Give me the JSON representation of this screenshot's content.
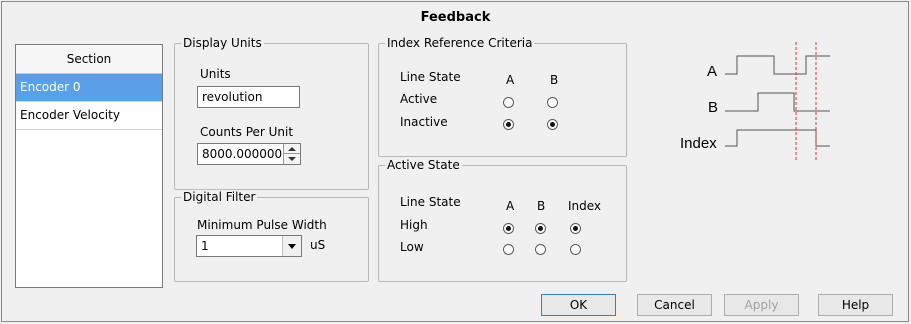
{
  "window": {
    "title": "Feedback"
  },
  "section": {
    "header": "Section",
    "items": [
      {
        "label": "Encoder 0",
        "selected": true
      },
      {
        "label": "Encoder Velocity",
        "selected": false
      }
    ]
  },
  "display_units": {
    "legend": "Display Units",
    "units_label": "Units",
    "units_value": "revolution",
    "counts_label": "Counts Per Unit",
    "counts_value": "8000.000000"
  },
  "digital_filter": {
    "legend": "Digital Filter",
    "min_pulse_label": "Minimum Pulse Width",
    "min_pulse_value": "1",
    "unit": "uS"
  },
  "index_ref": {
    "legend": "Index Reference Criteria",
    "line_state": "Line State",
    "col_a": "A",
    "col_b": "B",
    "row_active": "Active",
    "row_inactive": "Inactive",
    "selected": {
      "A": "Inactive",
      "B": "Inactive"
    }
  },
  "active_state": {
    "legend": "Active State",
    "line_state": "Line State",
    "col_a": "A",
    "col_b": "B",
    "col_index": "Index",
    "row_high": "High",
    "row_low": "Low",
    "selected": {
      "A": "High",
      "B": "High",
      "Index": "High"
    }
  },
  "diagram": {
    "labels": {
      "a": "A",
      "b": "B",
      "index": "Index"
    },
    "marker_color": "#e03030"
  },
  "buttons": {
    "ok": "OK",
    "cancel": "Cancel",
    "apply": "Apply",
    "help": "Help"
  }
}
